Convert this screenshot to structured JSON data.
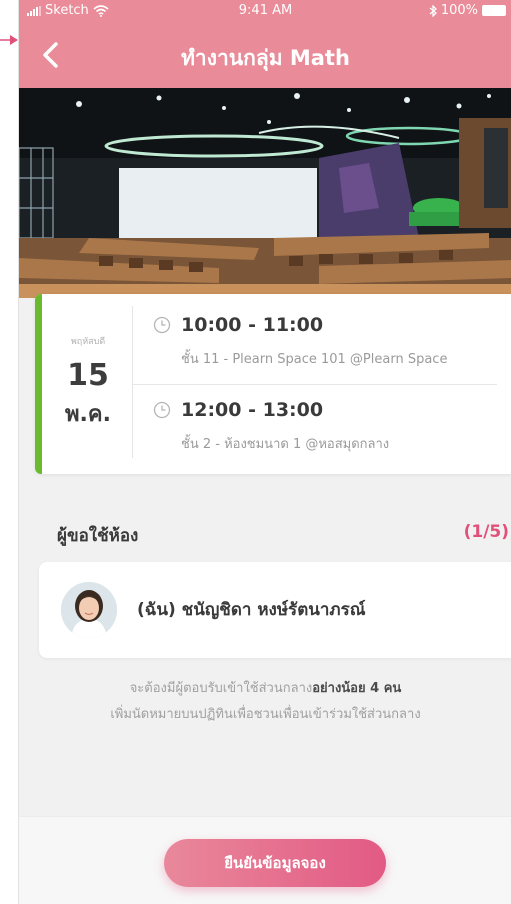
{
  "status_bar": {
    "carrier": "Sketch",
    "time": "9:41 AM",
    "battery": "100%"
  },
  "nav": {
    "title": "ทำงานกลุ่ม Math",
    "back_icon": "chevron-left-icon"
  },
  "booking": {
    "day_name": "พฤหัสบดี",
    "day_number": "15",
    "month": "พ.ค.",
    "slots": [
      {
        "time": "10:00 - 11:00",
        "place": "ชั้น 11 - Plearn Space 101 @Plearn Space"
      },
      {
        "time": "12:00 - 13:00",
        "place": "ชั้น 2 - ห้องชมนาด 1 @หอสมุดกลาง"
      }
    ]
  },
  "requesters": {
    "title": "ผู้ขอใช้ห้อง",
    "count": "(1/5)",
    "users": [
      {
        "name": "(ฉัน) ชนัญชิดา หงษ์รัตนาภรณ์"
      }
    ]
  },
  "note": {
    "line1_prefix": "จะต้องมีผู้ตอบรับเข้าใช้ส่วนกลาง",
    "line1_emphasis": "อย่างน้อย 4 คน",
    "line2": "เพิ่มนัดหมายบนปฏิทินเพื่อชวนเพื่อนเข้าร่วมใช้ส่วนกลาง"
  },
  "actions": {
    "confirm_label": "ยืนยันข้อมูลจอง"
  },
  "colors": {
    "header": "#e98b98",
    "accent_green": "#6aba2e",
    "count_pink": "#e0517a",
    "button_gradient_start": "#e9889b",
    "button_gradient_end": "#e25a84"
  }
}
